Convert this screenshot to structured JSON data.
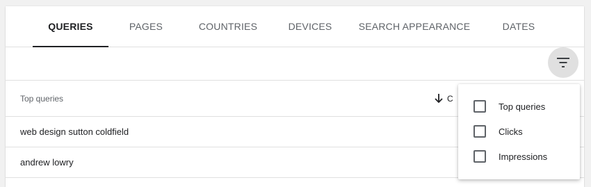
{
  "tabs": [
    {
      "label": "QUERIES",
      "active": true
    },
    {
      "label": "PAGES",
      "active": false
    },
    {
      "label": "COUNTRIES",
      "active": false
    },
    {
      "label": "DEVICES",
      "active": false
    },
    {
      "label": "SEARCH APPEARANCE",
      "active": false
    },
    {
      "label": "DATES",
      "active": false
    }
  ],
  "toolbar": {
    "filter_icon": "filter-list-icon"
  },
  "table": {
    "column_title": "Top queries",
    "sort_column_visible_text": "C",
    "sort_icon": "arrow-down-icon",
    "rows": [
      {
        "query": "web design sutton coldfield"
      },
      {
        "query": "andrew lowry"
      }
    ]
  },
  "filter_menu": {
    "options": [
      {
        "label": "Top queries",
        "checked": false
      },
      {
        "label": "Clicks",
        "checked": false
      },
      {
        "label": "Impressions",
        "checked": false
      }
    ]
  },
  "colors": {
    "active_tab": "#202124",
    "inactive_tab": "#5f6368",
    "divider": "#e0e0e0",
    "filter_button_bg": "#e0e0e0"
  }
}
